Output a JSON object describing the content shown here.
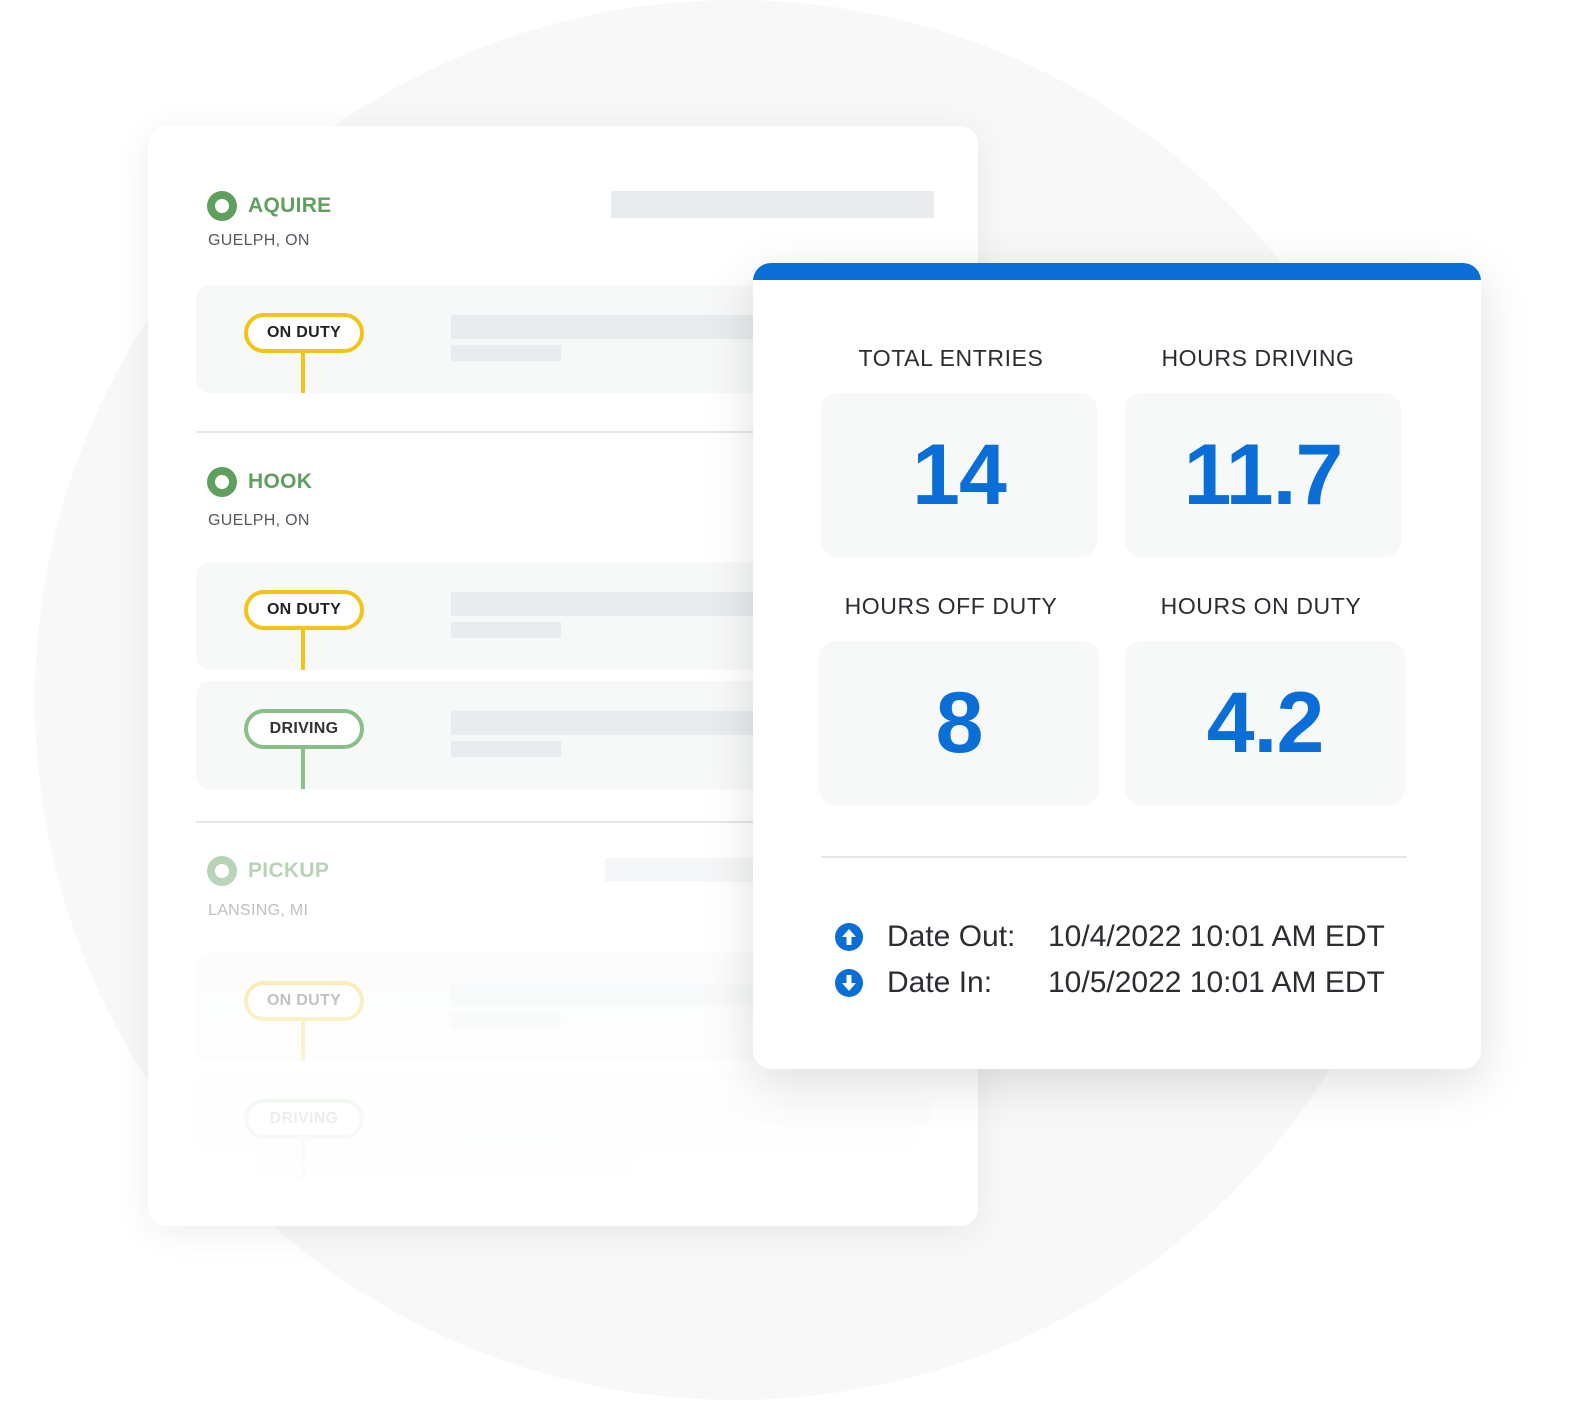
{
  "log": {
    "stops": [
      {
        "name": "AQUIRE",
        "location": "GUELPH, ON",
        "entries": [
          {
            "status": "ON DUTY"
          }
        ]
      },
      {
        "name": "HOOK",
        "location": "GUELPH, ON",
        "entries": [
          {
            "status": "ON DUTY"
          },
          {
            "status": "DRIVING"
          }
        ]
      },
      {
        "name": "PICKUP",
        "location": "LANSING, MI",
        "entries": [
          {
            "status": "ON DUTY"
          },
          {
            "status": "DRIVING"
          }
        ]
      }
    ]
  },
  "summary": {
    "stats": [
      {
        "label": "TOTAL ENTRIES",
        "value": "14"
      },
      {
        "label": "HOURS DRIVING",
        "value": "11.7"
      },
      {
        "label": "HOURS OFF DUTY",
        "value": "8"
      },
      {
        "label": "HOURS ON DUTY",
        "value": "4.2"
      }
    ],
    "date_out": {
      "label": "Date Out:",
      "value": "10/4/2022 10:01 AM EDT",
      "icon": "arrow-up-circle-icon"
    },
    "date_in": {
      "label": "Date In:",
      "value": "10/5/2022 10:01 AM EDT",
      "icon": "arrow-down-circle-icon"
    }
  },
  "colors": {
    "accent_blue": "#0a6ed6",
    "stop_green": "#5fa05d",
    "on_duty_yellow": "#f2c418",
    "driving_green": "#8bbf8a"
  }
}
